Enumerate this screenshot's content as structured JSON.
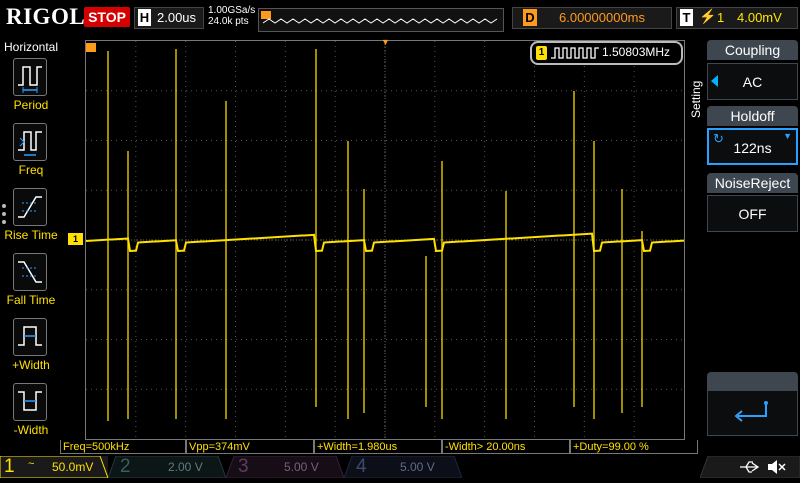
{
  "header": {
    "logo": "RIGOL",
    "run_state": "STOP",
    "horizontal_key": "H",
    "timebase": "2.00us",
    "sample_rate": "1.00GSa/s",
    "memory_depth": "24.0k pts",
    "delay_key": "D",
    "delay": "6.00000000ms",
    "trigger_key": "T",
    "trigger_slope_icon": "rising-edge-icon",
    "trigger_source_indicator": "1",
    "trigger_level": "4.00mV"
  },
  "left_menu": {
    "title": "Horizontal",
    "items": [
      {
        "label": "Period",
        "icon": "period-icon"
      },
      {
        "label": "Freq",
        "icon": "frequency-icon"
      },
      {
        "label": "Rise Time",
        "icon": "rise-time-icon"
      },
      {
        "label": "Fall Time",
        "icon": "fall-time-icon"
      },
      {
        "label": "+Width",
        "icon": "positive-width-icon"
      },
      {
        "label": "-Width",
        "icon": "negative-width-icon"
      }
    ]
  },
  "display": {
    "channel_marker": "1",
    "freq_counter_channel": "1",
    "freq_counter_value": "1.50803MHz",
    "trace_color": "#ffe000"
  },
  "right_panel": {
    "settings_tab": "Setting",
    "coupling_label": "Coupling",
    "coupling_value": "AC",
    "holdoff_label": "Holdoff",
    "holdoff_value": "122ns",
    "noise_reject_label": "NoiseReject",
    "noise_reject_value": "OFF",
    "back_icon": "return-arrow-icon"
  },
  "measurements": [
    "Freq=500kHz",
    "Vpp=374mV",
    "+Width=1.980us",
    "-Width> 20.00ns",
    "+Duty=99.00 %"
  ],
  "channels": [
    {
      "number": "1",
      "coupling": "~",
      "scale": "50.0mV",
      "color": "#ffe000",
      "active": true
    },
    {
      "number": "2",
      "coupling": "",
      "scale": "2.00 V",
      "color": "#00e0e0",
      "active": false
    },
    {
      "number": "3",
      "coupling": "",
      "scale": "5.00 V",
      "color": "#e000e0",
      "active": false
    },
    {
      "number": "4",
      "coupling": "",
      "scale": "5.00 V",
      "color": "#3a78ff",
      "active": false
    }
  ],
  "status_icons": [
    "usb-icon",
    "speaker-muted-icon"
  ]
}
